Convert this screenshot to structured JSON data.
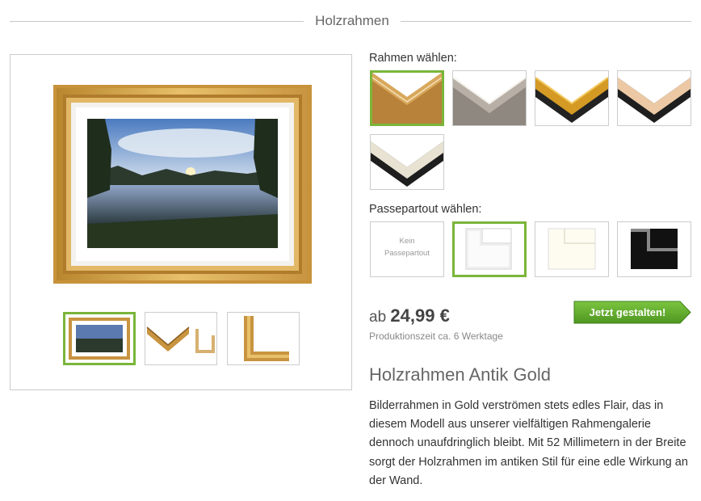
{
  "header": {
    "title": "Holzrahmen"
  },
  "frame_section": {
    "label": "Rahmen wählen:",
    "options": [
      "gold-wood",
      "silver-grey",
      "gold-black",
      "natural-black",
      "cream-black"
    ],
    "selected": 0
  },
  "passepartout_section": {
    "label": "Passepartout wählen:",
    "none_line1": "Kein",
    "none_line2": "Passepartout",
    "options": [
      "none",
      "white",
      "cream",
      "black"
    ],
    "selected": 1
  },
  "price": {
    "prefix": "ab",
    "value": "24,99 €",
    "production": "Produktionszeit ca. 6 Werktage"
  },
  "cta": {
    "label": "Jetzt gestalten!"
  },
  "product": {
    "title": "Holzrahmen Antik Gold",
    "description": "Bilderrahmen in Gold verströmen stets edles Flair, das in diesem Modell aus unserer vielfältigen Rahmengalerie dennoch unaufdringlich bleibt. Mit 52 Millimetern in der Breite sorgt der Holzrahmen im antiken Stil für eine edle Wirkung an der Wand."
  },
  "gallery": {
    "thumbnails": [
      "framed-photo",
      "frame-profile",
      "frame-corner"
    ],
    "selected": 0
  },
  "colors": {
    "accent_green": "#7ab53a",
    "cta_green": "#5fa829",
    "gold": "#d4a24a"
  }
}
